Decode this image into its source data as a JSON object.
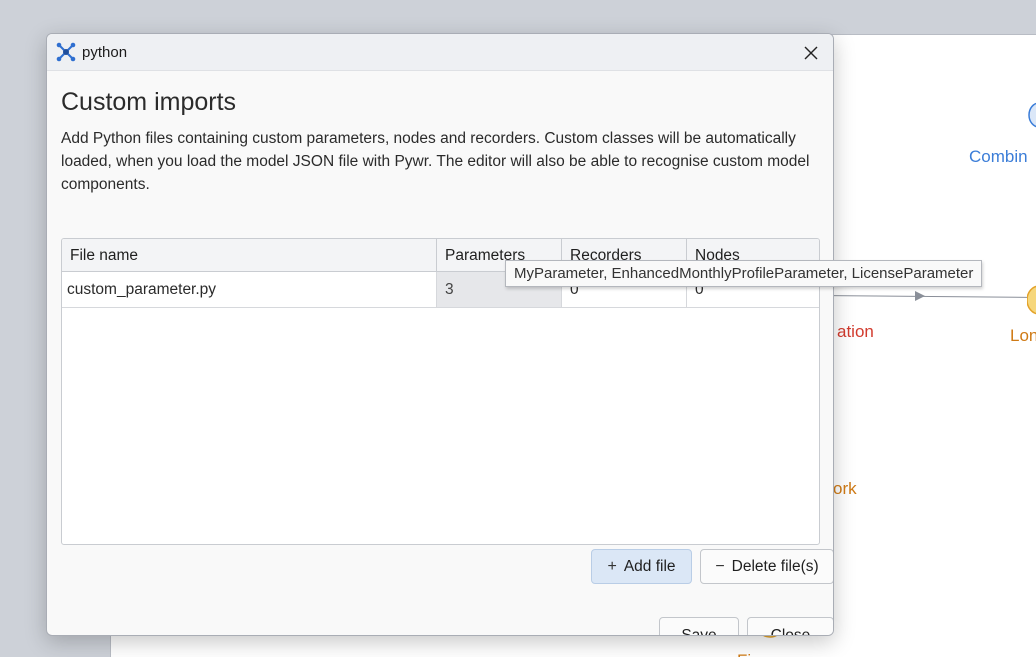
{
  "background": {
    "labels": {
      "combined": "Combin",
      "allocation": "ation",
      "lon": "Lon",
      "work": "ork",
      "bottom": "Fi"
    },
    "colors": {
      "blue_label": "#3b7dd8",
      "red_label": "#d23b2e",
      "orange_label": "#cf7a15",
      "node_fill": "#f6d77c",
      "node_stroke": "#e3a22a"
    }
  },
  "dialog": {
    "window_title": "python",
    "heading": "Custom imports",
    "description": "Add Python files containing custom parameters, nodes and recorders. Custom classes will be automatically loaded, when you load the model JSON file with Pywr. The editor will also be able to recognise custom model components.",
    "table": {
      "columns": [
        "File name",
        "Parameters",
        "Recorders",
        "Nodes"
      ],
      "rows": [
        {
          "file_name": "custom_parameter.py",
          "parameters": "3",
          "recorders": "0",
          "nodes": "0"
        }
      ]
    },
    "tooltip": "MyParameter, EnhancedMonthlyProfileParameter, LicenseParameter",
    "buttons": {
      "add_file": "Add file",
      "delete_files": "Delete file(s)",
      "save": "Save",
      "close": "Close"
    },
    "icons": {
      "app": "network-icon",
      "close": "close-icon",
      "add": "plus-icon",
      "delete": "minus-icon"
    }
  }
}
